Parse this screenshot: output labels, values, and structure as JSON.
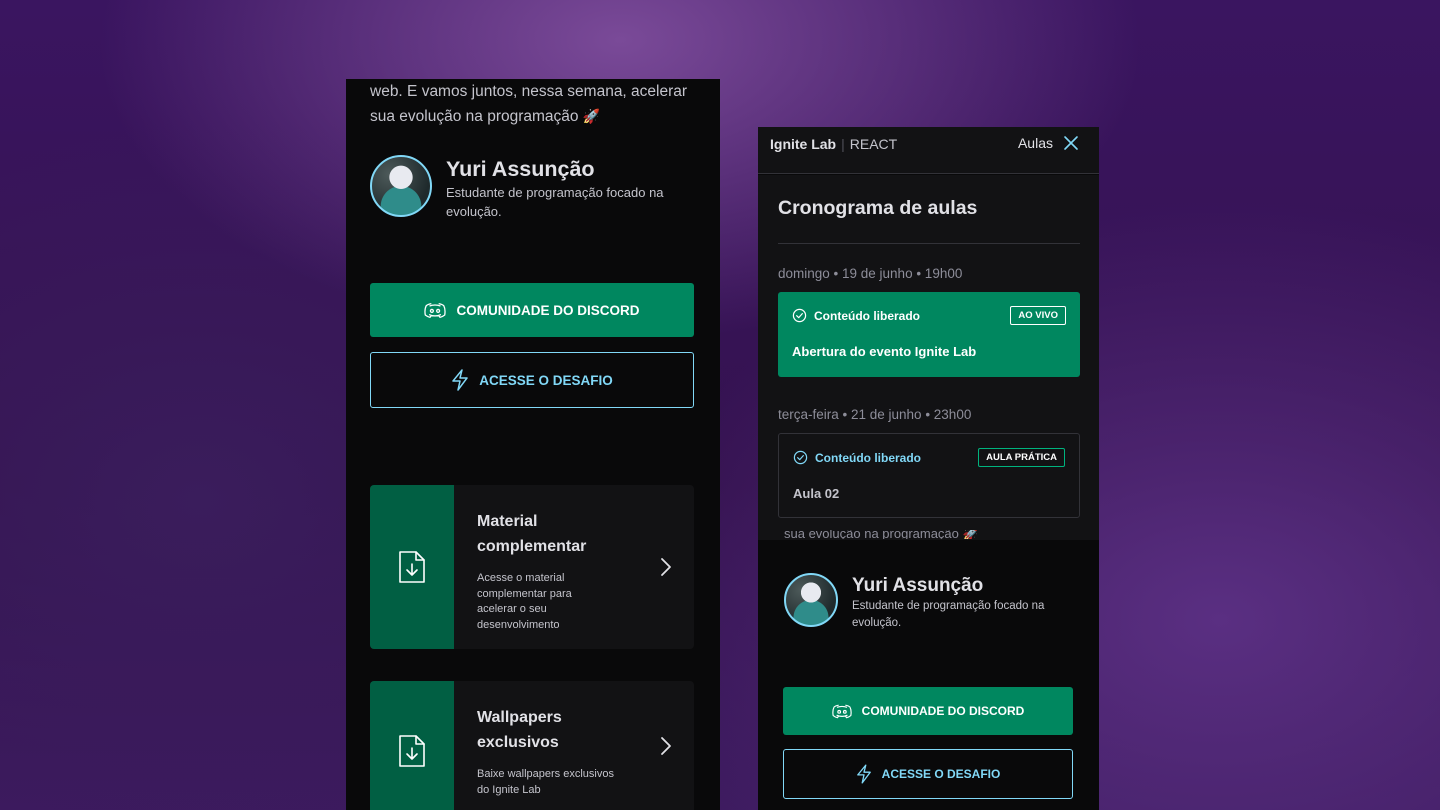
{
  "left_phone": {
    "intro_line1": "web. E vamos juntos, nessa semana, acelerar",
    "intro_line2": "sua evolução na programação",
    "intro_emoji": "🚀",
    "profile": {
      "name": "Yuri Assunção",
      "bio": "Estudante de programação focado na evolução."
    },
    "discord_button": "COMUNIDADE DO DISCORD",
    "challenge_button": "ACESSE O DESAFIO",
    "cards": [
      {
        "title": "Material complementar",
        "description": "Acesse o material complementar para acelerar o seu desenvolvimento"
      },
      {
        "title": "Wallpapers exclusivos",
        "description": "Baixe wallpapers exclusivos do Ignite Lab"
      }
    ]
  },
  "right_phone": {
    "header": {
      "brand": "Ignite Lab",
      "separator": "|",
      "tech": "REACT",
      "menu_label": "Aulas"
    },
    "schedule": {
      "title": "Cronograma de aulas",
      "lessons": [
        {
          "date": "domingo • 19 de junho • 19h00",
          "status": "Conteúdo liberado",
          "badge": "AO VIVO",
          "title": "Abertura do evento Ignite Lab"
        },
        {
          "date": "terça-feira • 21 de junho • 23h00",
          "status": "Conteúdo liberado",
          "badge": "AULA PRÁTICA",
          "title": "Aula 02"
        }
      ]
    },
    "under_text": "sua evolução na programação 🚀",
    "profile": {
      "name": "Yuri Assunção",
      "bio": "Estudante de programação focado na evolução."
    },
    "discord_button": "COMUNIDADE DO DISCORD",
    "challenge_button": "ACESSE O DESAFIO"
  },
  "colors": {
    "brand_green": "#00875f",
    "dark_green": "#015f43",
    "accent_blue": "#81d8f7",
    "background": "#09090a"
  },
  "icons": [
    "discord-icon",
    "lightning-icon",
    "file-download-icon",
    "chevron-right-icon",
    "close-icon",
    "check-circle-icon"
  ]
}
